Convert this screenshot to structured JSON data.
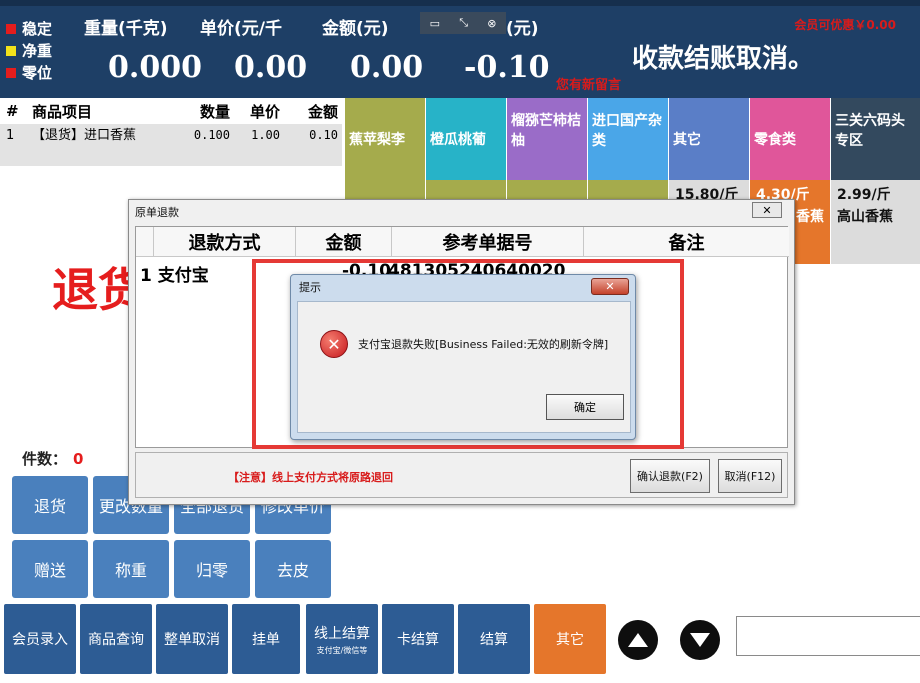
{
  "status": {
    "stable": {
      "label": "稳定",
      "color": "#e51d1d"
    },
    "net_weight": {
      "label": "净重",
      "color": "#f2e21b"
    },
    "zero": {
      "label": "零位",
      "color": "#e51d1d"
    }
  },
  "header": {
    "weight_label": "重量(千克)",
    "weight_value": "0.000",
    "unit_price_label": "单价(元/千",
    "unit_price_value": "0.00",
    "amount_label": "金额(元)",
    "amount_value": "0.00",
    "change_label": "(元)",
    "change_value": "-0.10",
    "member_discount": "会员可优惠￥0.00",
    "new_message": "您有新留言",
    "checkout_message": "收款结账取消。"
  },
  "items": {
    "headers": [
      "#",
      "商品项目",
      "数量",
      "单价",
      "金额"
    ],
    "rows": [
      {
        "no": "1",
        "name": "【退货】进口香蕉",
        "qty": "0.100",
        "price": "1.00",
        "amount": "0.10"
      }
    ]
  },
  "categories": [
    {
      "label": "蕉苹梨李",
      "color": "#a5ab4c"
    },
    {
      "label": "橙瓜桃葡",
      "color": "#27b3c8"
    },
    {
      "label": "榴猕芒柿桔柚",
      "color": "#9a6cc8"
    },
    {
      "label": "进口国产杂类",
      "color": "#4aa6e8"
    },
    {
      "label": "其它",
      "color": "#5a7ec7"
    },
    {
      "label": "零食类",
      "color": "#e0569a"
    },
    {
      "label": "三关六码头专区",
      "color": "#33495e"
    }
  ],
  "products": [
    {
      "price": "15.80/斤",
      "name": "",
      "color": "#dcdcdc",
      "text": "#111111"
    },
    {
      "price": "4.30/斤",
      "name": "香蕉",
      "color": "#e5762b",
      "text": "#ffffff"
    },
    {
      "price": "2.99/斤",
      "name": "高山香蕉",
      "color": "#dcdcdc",
      "text": "#111111"
    }
  ],
  "big_return_text": "退货",
  "piece_count": {
    "label": "件数：",
    "value": "0"
  },
  "action_buttons": [
    "退货",
    "更改数量",
    "全部退货",
    "修改单价",
    "赠送",
    "称重",
    "归零",
    "去皮"
  ],
  "bottom_buttons": [
    {
      "label": "会员录入",
      "sub": ""
    },
    {
      "label": "商品查询",
      "sub": ""
    },
    {
      "label": "整单取消",
      "sub": ""
    },
    {
      "label": "挂单",
      "sub": ""
    },
    {
      "label": "线上结算",
      "sub": "支付宝/微信等"
    },
    {
      "label": "卡结算",
      "sub": ""
    },
    {
      "label": "结算",
      "sub": ""
    },
    {
      "label": "其它",
      "sub": ""
    }
  ],
  "refund_window": {
    "title": "原单退款",
    "columns": [
      "退款方式",
      "金额",
      "参考单据号",
      "备注"
    ],
    "rows": [
      {
        "method": "1 支付宝",
        "amount": "-0.10",
        "ref": "481305240640020"
      }
    ],
    "notice": "【注意】线上支付方式将原路退回",
    "confirm_label": "确认退款(F2)",
    "cancel_label": "取消(F12)"
  },
  "alert": {
    "title": "提示",
    "message": "支付宝退款失败[Business Failed:无效的刷新令牌]",
    "ok_label": "确定"
  }
}
